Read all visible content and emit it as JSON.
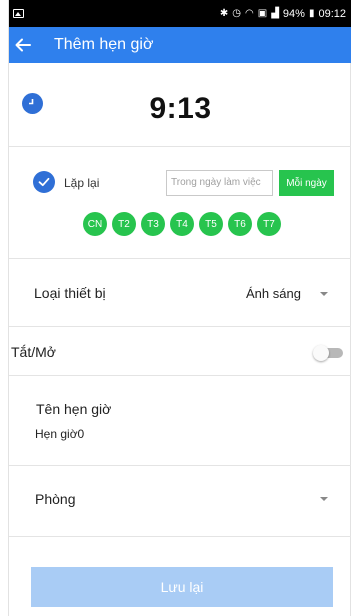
{
  "status_bar": {
    "battery": "94%",
    "time": "09:12"
  },
  "app_bar": {
    "title": "Thêm hẹn giờ"
  },
  "clock": {
    "time": "9:13"
  },
  "repeat": {
    "label": "Lặp lại",
    "weekday_placeholder": "Trong ngày làm việc",
    "everyday_label": "Mỗi ngày",
    "days": [
      "CN",
      "T2",
      "T3",
      "T4",
      "T5",
      "T6",
      "T7"
    ]
  },
  "device_type": {
    "label": "Loại thiết bị",
    "value": "Ánh sáng"
  },
  "on_off": {
    "label": "Tắt/Mở",
    "enabled": false
  },
  "timer_name": {
    "label": "Tên hẹn giờ",
    "value": "Hẹn giờ0"
  },
  "room": {
    "label": "Phòng",
    "value": ""
  },
  "save": {
    "label": "Lưu lại"
  },
  "colors": {
    "primary": "#2f80ed",
    "green": "#27c44e",
    "save_disabled": "#a9ccf5"
  }
}
